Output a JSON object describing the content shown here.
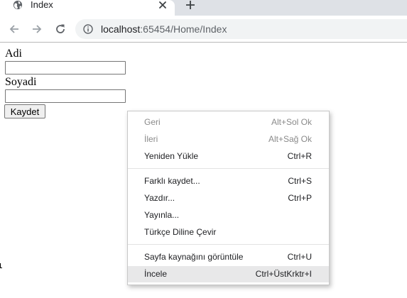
{
  "browser": {
    "tab_title": "Index",
    "url_host": "localhost",
    "url_rest": ":65454/Home/Index"
  },
  "form": {
    "first_name_label": "Adi",
    "first_name_value": "",
    "last_name_label": "Soyadi",
    "last_name_value": "",
    "submit_label": "Kaydet"
  },
  "context_menu": {
    "items": [
      {
        "label": "Geri",
        "shortcut": "Alt+Sol Ok",
        "disabled": true
      },
      {
        "label": "İleri",
        "shortcut": "Alt+Sağ Ok",
        "disabled": true
      },
      {
        "label": "Yeniden Yükle",
        "shortcut": "Ctrl+R",
        "disabled": false
      },
      {
        "label": "Farklı kaydet...",
        "shortcut": "Ctrl+S",
        "disabled": false
      },
      {
        "label": "Yazdır...",
        "shortcut": "Ctrl+P",
        "disabled": false
      },
      {
        "label": "Yayınla...",
        "shortcut": "",
        "disabled": false
      },
      {
        "label": "Türkçe Diline Çevir",
        "shortcut": "",
        "disabled": false
      },
      {
        "label": "Sayfa kaynağını görüntüle",
        "shortcut": "Ctrl+U",
        "disabled": false
      },
      {
        "label": "İncele",
        "shortcut": "Ctrl+ÜstKrktr+I",
        "disabled": false,
        "highlighted": true
      }
    ]
  },
  "colors": {
    "tabstrip": "#dee1e6",
    "omnibox": "#f1f3f4",
    "menu_hover": "#e8e8e9",
    "disabled_text": "#8a8a8a"
  }
}
